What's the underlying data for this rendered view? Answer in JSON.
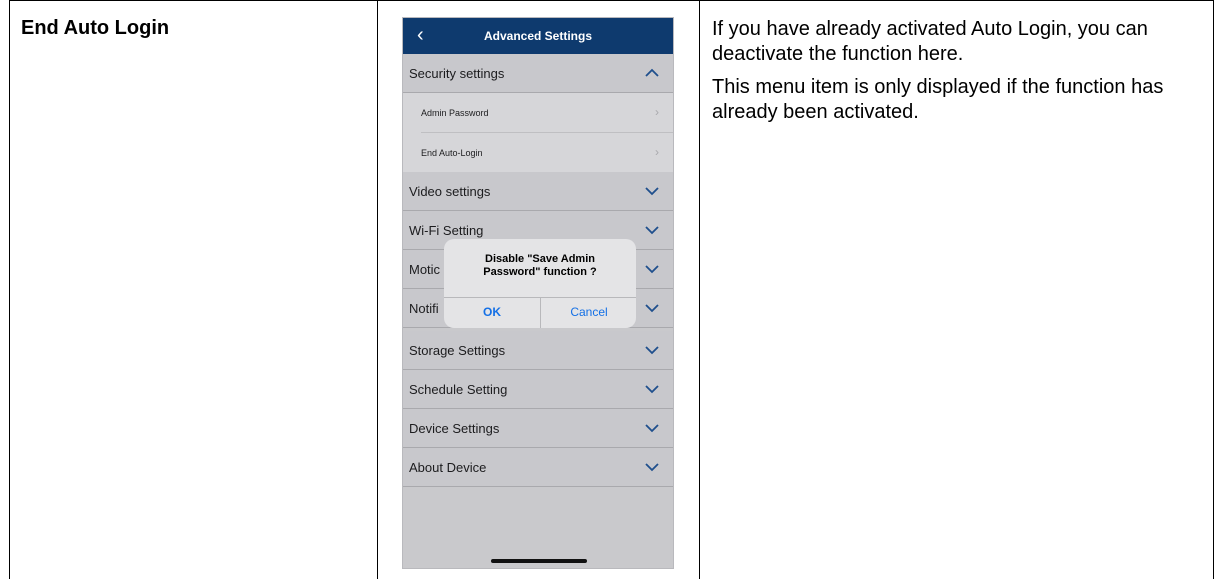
{
  "doc": {
    "heading": "End Auto Login",
    "paragraphs": [
      "If you have already activated Auto Login, you can deactivate the function here.",
      "This menu item is only displayed if the function has already been activated."
    ]
  },
  "phone": {
    "nav": {
      "back_icon": "chevron-left-icon",
      "title": "Advanced Settings"
    },
    "sections": {
      "security": {
        "label": "Security settings",
        "chevron": "chevron-up-icon"
      },
      "video": {
        "label": "Video settings"
      },
      "wifi": {
        "label": "Wi-Fi Setting"
      },
      "motion": {
        "label": "Motic"
      },
      "notification": {
        "label": "Notifi"
      },
      "storage": {
        "label": "Storage Settings"
      },
      "schedule": {
        "label": "Schedule Setting"
      },
      "device": {
        "label": "Device Settings"
      },
      "about": {
        "label": "About Device"
      }
    },
    "security_items": {
      "admin_password": "Admin Password",
      "end_auto_login": "End Auto-Login"
    },
    "dialog": {
      "message_line1": "Disable \"Save Admin",
      "message_line2": "Password\" function ?",
      "ok": "OK",
      "cancel": "Cancel"
    },
    "colors": {
      "nav": "#0e3a6e",
      "chevron": "#1f4f8c",
      "button": "#1470e6"
    }
  }
}
